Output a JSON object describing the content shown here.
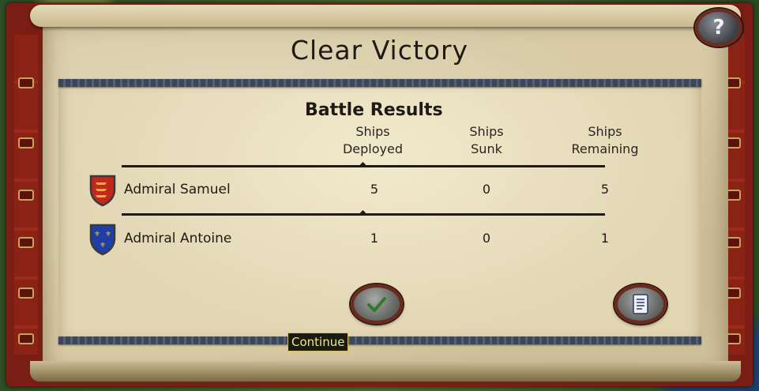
{
  "dialog": {
    "title": "Clear Victory",
    "help_label": "?"
  },
  "results": {
    "heading": "Battle Results",
    "columns": [
      {
        "line1": "Ships",
        "line2": "Deployed"
      },
      {
        "line1": "Ships",
        "line2": "Sunk"
      },
      {
        "line1": "Ships",
        "line2": "Remaining"
      }
    ],
    "rows": [
      {
        "name": "Admiral Samuel",
        "deployed": "5",
        "sunk": "0",
        "remaining": "5",
        "shield_icon": "english-lions-shield-icon"
      },
      {
        "name": "Admiral Antoine",
        "deployed": "1",
        "sunk": "0",
        "remaining": "1",
        "shield_icon": "french-fleur-de-lis-shield-icon"
      }
    ]
  },
  "buttons": {
    "continue_icon": "checkmark-icon",
    "report_icon": "scroll-document-icon"
  },
  "tooltip": {
    "text": "Continue"
  },
  "colors": {
    "border_red": "#7a1d14",
    "parchment": "#d8cba6",
    "tooltip_text": "#f0e68c",
    "english_red": "#c0281c",
    "french_blue": "#1f3fa6"
  }
}
